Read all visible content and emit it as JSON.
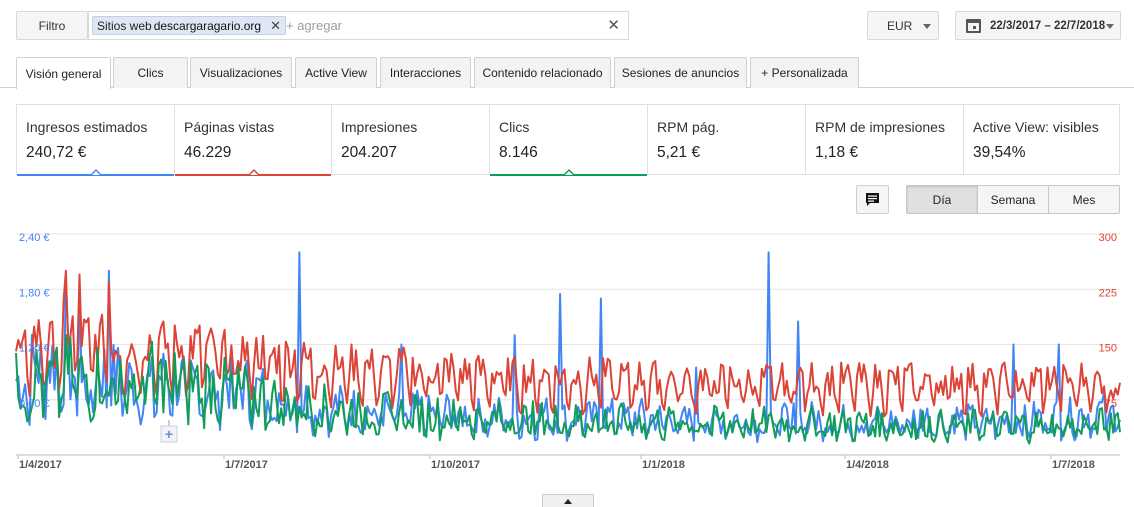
{
  "toolbar": {
    "filter_label": "Filtro",
    "chip_prefix": "Sitios web",
    "chip_value": "descargaragario.org",
    "chip_remove": "✕",
    "add_placeholder": "+ agregar",
    "clear": "✕",
    "currency": "EUR",
    "date_range": "22/3/2017 – 22/7/2018"
  },
  "tabs": [
    {
      "label": "Visión general"
    },
    {
      "label": "Clics"
    },
    {
      "label": "Visualizaciones"
    },
    {
      "label": "Active View"
    },
    {
      "label": "Interacciones"
    },
    {
      "label": "Contenido relacionado"
    },
    {
      "label": "Sesiones de anuncios"
    },
    {
      "label": "+  Personalizada"
    }
  ],
  "metrics": [
    {
      "name": "Ingresos estimados",
      "value": "240,72 €",
      "color": "#4285f4",
      "selected": true
    },
    {
      "name": "Páginas vistas",
      "value": "46.229",
      "color": "#db4437",
      "selected": true
    },
    {
      "name": "Impresiones",
      "value": "204.207",
      "selected": false
    },
    {
      "name": "Clics",
      "value": "8.146",
      "color": "#0f9d58",
      "selected": true
    },
    {
      "name": "RPM pág.",
      "value": "5,21 €",
      "selected": false
    },
    {
      "name": "RPM de impresiones",
      "value": "1,18 €",
      "selected": false
    },
    {
      "name": "Active View: visibles",
      "value": "39,54%",
      "selected": false
    }
  ],
  "granularity": [
    "Día",
    "Semana",
    "Mes"
  ],
  "granularity_selected": "Día",
  "chart_data": {
    "type": "line",
    "left_axis": {
      "ticks": [
        "2,40 €",
        "1,80 €",
        "1,20 €",
        "0,60 €"
      ],
      "ylim": [
        0,
        2.4
      ],
      "unit": "EUR"
    },
    "right_axis": {
      "ticks": [
        "300",
        "225",
        "150",
        "75"
      ],
      "ylim": [
        0,
        300
      ]
    },
    "x_ticks": [
      "1/4/2017",
      "1/7/2017",
      "1/10/2017",
      "1/1/2018",
      "1/4/2018",
      "1/7/2018"
    ],
    "x_range": [
      "22/3/2017",
      "22/7/2018"
    ],
    "annotation_marker": "+",
    "series": [
      {
        "name": "Ingresos estimados",
        "axis": "left",
        "color": "#4285f4",
        "weekly_avg": [
          0.75,
          0.9,
          0.95,
          0.85,
          0.7,
          0.85,
          0.8,
          0.75,
          0.7,
          0.8,
          0.75,
          0.72,
          0.7,
          0.75,
          0.7,
          0.65,
          0.6,
          0.58,
          0.55,
          0.5,
          0.5,
          0.48,
          0.45,
          0.45,
          0.42,
          0.45,
          0.42,
          0.45,
          0.42,
          0.4,
          0.42,
          0.4,
          0.4,
          0.42,
          0.38,
          0.4,
          0.38,
          0.4,
          0.38,
          0.4,
          0.38,
          0.38,
          0.35,
          0.38,
          0.36,
          0.38,
          0.36,
          0.35,
          0.36,
          0.38,
          0.38,
          0.35,
          0.36,
          0.35,
          0.36,
          0.35,
          0.36,
          0.38,
          0.36,
          0.38,
          0.36,
          0.35,
          0.36,
          0.35,
          0.38,
          0.4,
          0.4,
          0.42,
          0.45,
          0.42
        ],
        "peaks": [
          1.9,
          1.75,
          2.0,
          1.1,
          2.2,
          1.2,
          1.3,
          1.75,
          1.7,
          0.95,
          2.2,
          1.45,
          1.2,
          1.2
        ]
      },
      {
        "name": "Páginas vistas",
        "axis": "right",
        "color": "#db4437",
        "weekly_avg": [
          130,
          150,
          140,
          160,
          150,
          145,
          140,
          140,
          145,
          140,
          138,
          140,
          135,
          130,
          132,
          130,
          125,
          125,
          120,
          118,
          115,
          115,
          112,
          110,
          112,
          110,
          108,
          110,
          105,
          105,
          105,
          102,
          100,
          102,
          100,
          100,
          102,
          100,
          98,
          100,
          98,
          98,
          95,
          98,
          96,
          98,
          96,
          95,
          95,
          98,
          98,
          95,
          96,
          95,
          95,
          95,
          96,
          98,
          96,
          98,
          96,
          95,
          96,
          95,
          98,
          98,
          95,
          98,
          96,
          90
        ],
        "peaks": [
          250,
          245,
          235
        ]
      },
      {
        "name": "Clics",
        "axis": "right",
        "color": "#0f9d58",
        "weekly_avg": [
          90,
          100,
          95,
          105,
          100,
          100,
          95,
          95,
          100,
          95,
          95,
          92,
          90,
          85,
          80,
          75,
          70,
          68,
          65,
          62,
          60,
          58,
          56,
          55,
          54,
          53,
          52,
          50,
          50,
          49,
          48,
          48,
          47,
          47,
          46,
          46,
          46,
          45,
          45,
          45,
          44,
          44,
          44,
          44,
          43,
          43,
          43,
          42,
          42,
          42,
          42,
          41,
          41,
          41,
          41,
          40,
          40,
          40,
          40,
          40,
          40,
          40,
          40,
          40,
          40,
          40,
          40,
          40,
          42,
          48
        ]
      }
    ]
  }
}
